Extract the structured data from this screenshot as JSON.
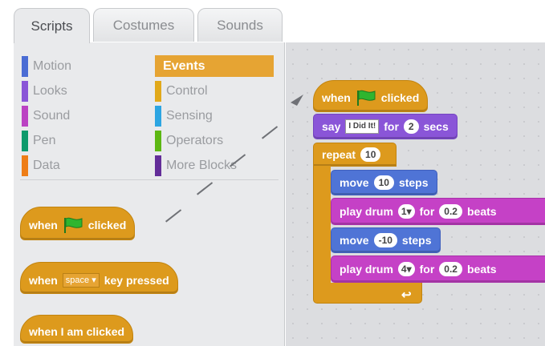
{
  "tabs": [
    {
      "label": "Scripts",
      "active": true
    },
    {
      "label": "Costumes",
      "active": false
    },
    {
      "label": "Sounds",
      "active": false
    }
  ],
  "categories": [
    {
      "label": "Motion",
      "color": "#4a6cd4"
    },
    {
      "label": "Looks",
      "color": "#8a55d7"
    },
    {
      "label": "Sound",
      "color": "#bb42c3"
    },
    {
      "label": "Pen",
      "color": "#0e9a6c"
    },
    {
      "label": "Data",
      "color": "#ee7d16"
    },
    {
      "label": "Events",
      "color": "#c88330",
      "selected": true
    },
    {
      "label": "Control",
      "color": "#e1a91a"
    },
    {
      "label": "Sensing",
      "color": "#2ca5e2"
    },
    {
      "label": "Operators",
      "color": "#5cb712"
    },
    {
      "label": "More Blocks",
      "color": "#632d99"
    }
  ],
  "palette_blocks": {
    "flag_hat": {
      "when": "when",
      "clicked": "clicked"
    },
    "key_hat": {
      "when": "when",
      "key": "space",
      "suffix": "key pressed"
    },
    "sprite_hat": {
      "label": "when I am clicked"
    }
  },
  "script": {
    "hat": {
      "when": "when",
      "clicked": "clicked"
    },
    "say": {
      "label": "say",
      "text": "I Did It!",
      "for": "for",
      "secs_value": "2",
      "secs": "secs"
    },
    "repeat": {
      "label": "repeat",
      "count": "10"
    },
    "move1": {
      "label": "move",
      "value": "10",
      "unit": "steps"
    },
    "drum1": {
      "label": "play drum",
      "drum": "1",
      "for": "for",
      "beats_value": "0.2",
      "beats": "beats"
    },
    "move2": {
      "label": "move",
      "value": "-10",
      "unit": "steps"
    },
    "drum2": {
      "label": "play drum",
      "drum": "4",
      "for": "for",
      "beats_value": "0.2",
      "beats": "beats"
    }
  },
  "colors": {
    "events": "#dd9a1d",
    "looks": "#8a55d8",
    "motion": "#4f74d6",
    "sound": "#c541c6",
    "flag": "#2fb52f"
  }
}
